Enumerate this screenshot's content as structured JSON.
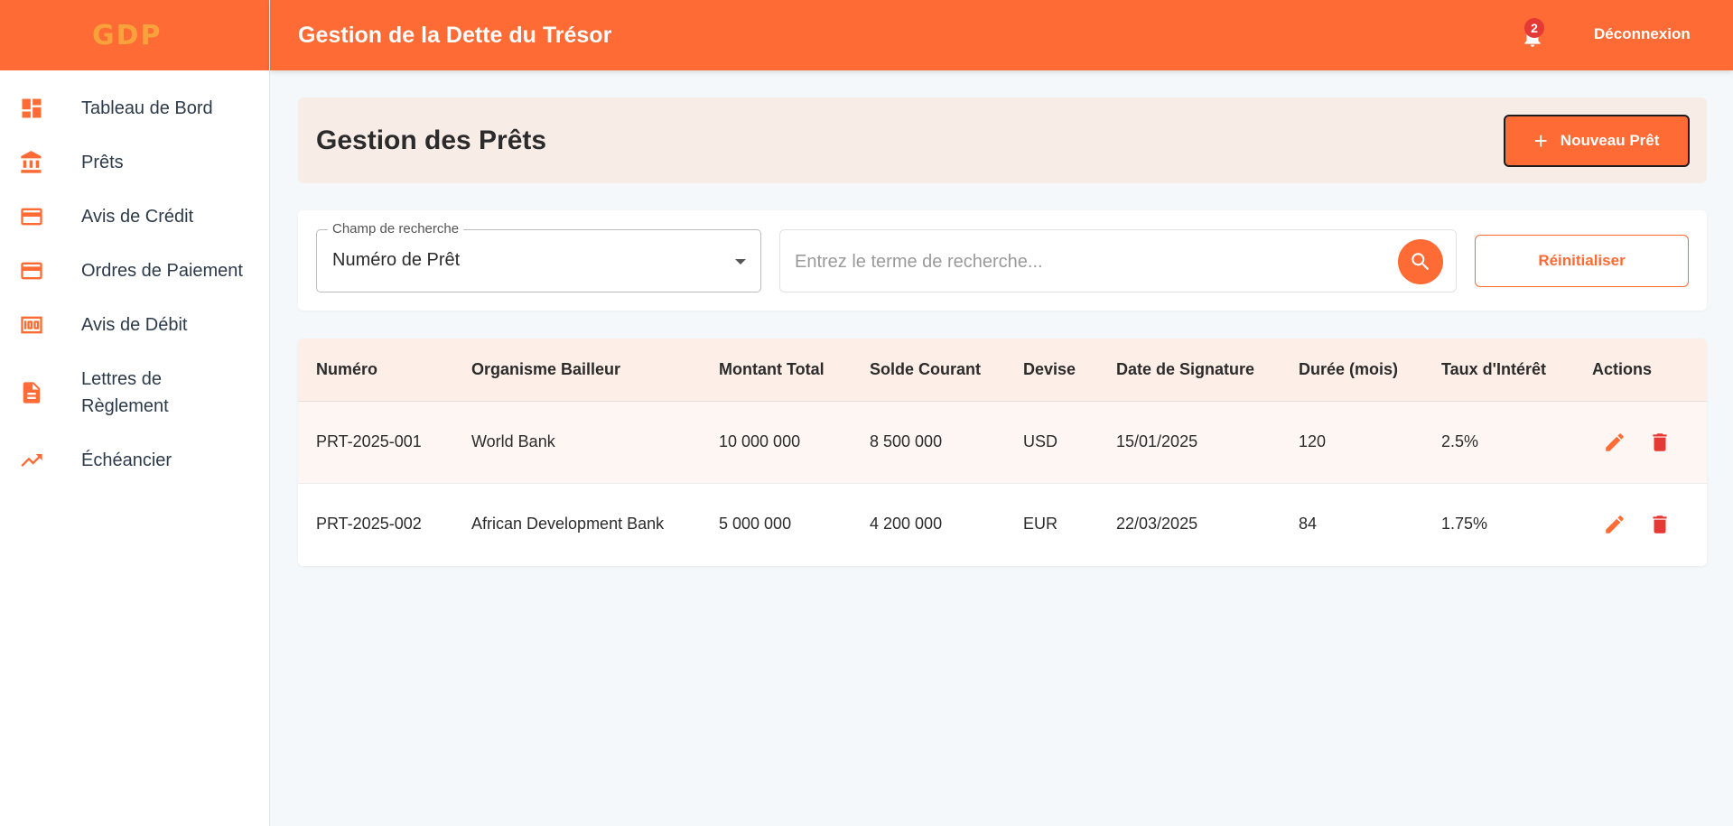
{
  "app": {
    "logo": "GDP",
    "title": "Gestion de la Dette du Trésor",
    "notification_count": "2",
    "logout_label": "Déconnexion"
  },
  "sidebar": {
    "items": [
      {
        "label": "Tableau de Bord",
        "icon": "dashboard-icon"
      },
      {
        "label": "Prêts",
        "icon": "bank-icon"
      },
      {
        "label": "Avis de Crédit",
        "icon": "credit-card-icon"
      },
      {
        "label": "Ordres de Paiement",
        "icon": "payment-card-icon"
      },
      {
        "label": "Avis de Débit",
        "icon": "money-icon"
      },
      {
        "label": "Lettres de Règlement",
        "icon": "document-icon"
      },
      {
        "label": "Échéancier",
        "icon": "trending-icon"
      }
    ]
  },
  "page": {
    "title": "Gestion des Prêts",
    "new_button": "Nouveau Prêt",
    "new_button_icon": "plus-icon"
  },
  "search": {
    "field_label": "Champ de recherche",
    "field_value": "Numéro de Prêt",
    "placeholder": "Entrez le terme de recherche...",
    "reset_label": "Réinitialiser"
  },
  "table": {
    "headers": [
      "Numéro",
      "Organisme Bailleur",
      "Montant Total",
      "Solde Courant",
      "Devise",
      "Date de Signature",
      "Durée (mois)",
      "Taux d'Intérêt",
      "Actions"
    ],
    "rows": [
      {
        "numero": "PRT-2025-001",
        "bailleur": "World Bank",
        "montant": "10 000 000",
        "solde": "8 500 000",
        "devise": "USD",
        "date": "15/01/2025",
        "duree": "120",
        "taux": "2.5%"
      },
      {
        "numero": "PRT-2025-002",
        "bailleur": "African Development Bank",
        "montant": "5 000 000",
        "solde": "4 200 000",
        "devise": "EUR",
        "date": "22/03/2025",
        "duree": "84",
        "taux": "1.75%"
      }
    ]
  },
  "colors": {
    "accent": "#ff6b35",
    "danger": "#e53935",
    "header_tint": "#fdeee7"
  }
}
